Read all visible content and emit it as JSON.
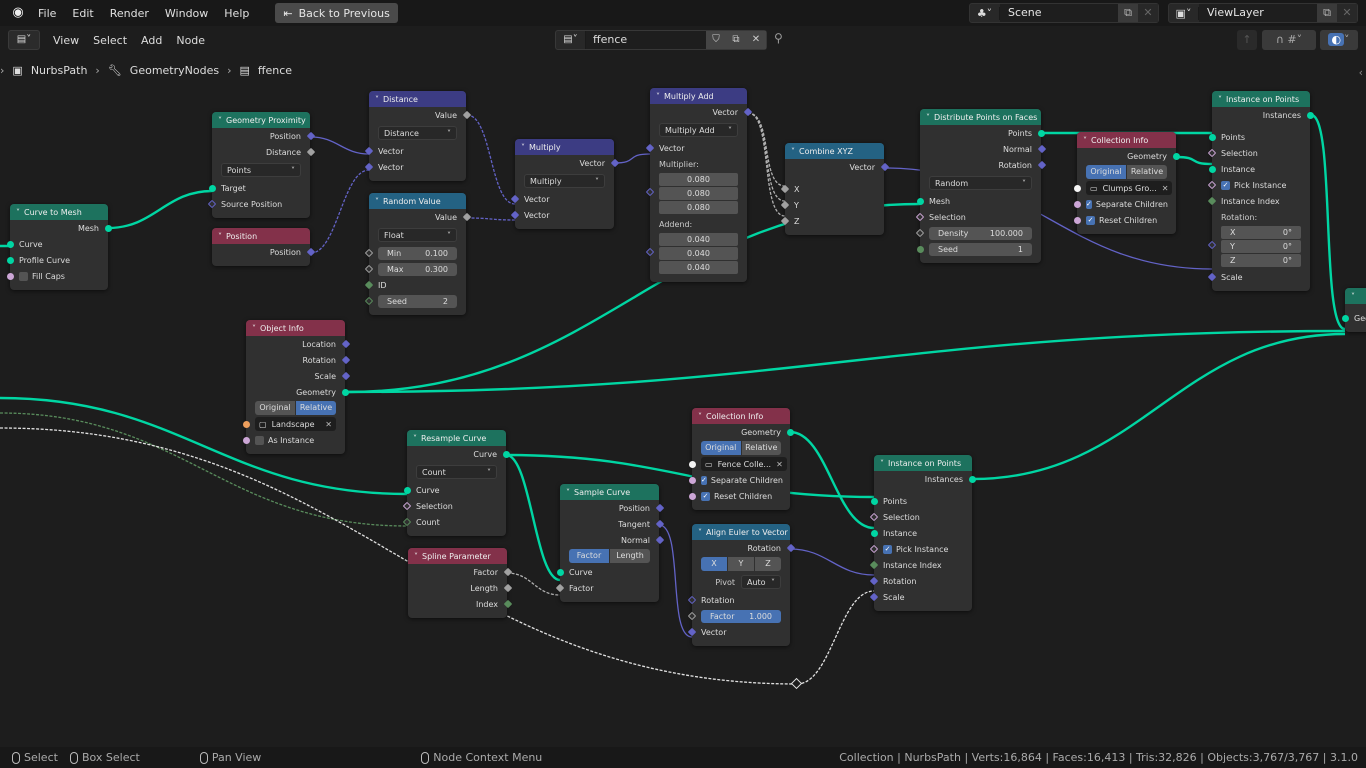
{
  "topbar": {
    "menus": [
      "File",
      "Edit",
      "Render",
      "Window",
      "Help"
    ],
    "back_button": "Back to Previous",
    "scene": "Scene",
    "view_layer": "ViewLayer"
  },
  "header": {
    "menus": [
      "View",
      "Select",
      "Add",
      "Node"
    ],
    "node_tree": "ffence"
  },
  "breadcrumb": [
    "NurbsPath",
    "GeometryNodes",
    "ffence"
  ],
  "colors": {
    "geometry_socket": "#00d6a3",
    "vector_socket": "#6363c7",
    "float_socket": "#a1a1a1",
    "bool_socket": "#cca6d6",
    "int_socket": "#598c5c",
    "object_socket": "#ed9e5c",
    "collection_socket": "#f5f5f5",
    "geometry_header": "#1d725e",
    "vector_header": "#3c3c83",
    "converter_header": "#246283",
    "input_header": "#83314a",
    "accent": "#4772b3"
  },
  "nodes": [
    {
      "title": "Curve to Mesh",
      "cat": "geometry",
      "rows": [
        {
          "t": "out",
          "label": "Mesh",
          "s": "geometry"
        },
        {
          "t": "in",
          "label": "Curve",
          "s": "geometry"
        },
        {
          "t": "in",
          "label": "Profile Curve",
          "s": "geometry"
        },
        {
          "t": "check",
          "label": "Fill Caps",
          "checked": false,
          "s": "bool"
        }
      ]
    },
    {
      "title": "Geometry Proximity",
      "cat": "geometry",
      "rows": [
        {
          "t": "out",
          "label": "Position",
          "s": "vector",
          "f": "d"
        },
        {
          "t": "out",
          "label": "Distance",
          "s": "float",
          "f": "d"
        },
        {
          "t": "select",
          "value": "Points"
        },
        {
          "t": "in",
          "label": "Target",
          "s": "geometry"
        },
        {
          "t": "in",
          "label": "Source Position",
          "s": "vector",
          "f": "dd"
        }
      ]
    },
    {
      "title": "Position",
      "cat": "input",
      "rows": [
        {
          "t": "out",
          "label": "Position",
          "s": "vector",
          "f": "d"
        }
      ]
    },
    {
      "title": "Distance",
      "cat": "vector",
      "rows": [
        {
          "t": "out",
          "label": "Value",
          "s": "float",
          "f": "d"
        },
        {
          "t": "select",
          "value": "Distance"
        },
        {
          "t": "in",
          "label": "Vector",
          "s": "vector",
          "f": "d"
        },
        {
          "t": "in",
          "label": "Vector",
          "s": "vector",
          "f": "d"
        }
      ]
    },
    {
      "title": "Random Value",
      "cat": "converter",
      "rows": [
        {
          "t": "out",
          "label": "Value",
          "s": "float",
          "f": "d"
        },
        {
          "t": "select",
          "value": "Float"
        },
        {
          "t": "field",
          "label": "Min",
          "value": "0.100",
          "s": "float",
          "f": "dd"
        },
        {
          "t": "field",
          "label": "Max",
          "value": "0.300",
          "s": "float",
          "f": "dd"
        },
        {
          "t": "in",
          "label": "ID",
          "s": "int",
          "f": "d"
        },
        {
          "t": "field",
          "label": "Seed",
          "value": "2",
          "s": "int",
          "f": "dd"
        }
      ]
    },
    {
      "title": "Multiply",
      "cat": "vector",
      "rows": [
        {
          "t": "out",
          "label": "Vector",
          "s": "vector",
          "f": "d"
        },
        {
          "t": "select",
          "value": "Multiply"
        },
        {
          "t": "in",
          "label": "Vector",
          "s": "vector",
          "f": "d"
        },
        {
          "t": "in",
          "label": "Vector",
          "s": "vector",
          "f": "d"
        }
      ]
    },
    {
      "title": "Multiply Add",
      "cat": "vector",
      "rows": [
        {
          "t": "out",
          "label": "Vector",
          "s": "vector",
          "f": "d"
        },
        {
          "t": "select",
          "value": "Multiply Add"
        },
        {
          "t": "in",
          "label": "Vector",
          "s": "vector",
          "f": "d"
        },
        {
          "t": "label",
          "label": "Multiplier:"
        },
        {
          "t": "vec",
          "values": [
            "0.080",
            "0.080",
            "0.080"
          ],
          "s": "vector",
          "f": "dd"
        },
        {
          "t": "label",
          "label": "Addend:"
        },
        {
          "t": "vec",
          "values": [
            "0.040",
            "0.040",
            "0.040"
          ],
          "s": "vector",
          "f": "dd"
        }
      ]
    },
    {
      "title": "Combine XYZ",
      "cat": "converter",
      "rows": [
        {
          "t": "out",
          "label": "Vector",
          "s": "vector",
          "f": "d"
        },
        {
          "t": "gap"
        },
        {
          "t": "in",
          "label": "X",
          "s": "float",
          "f": "d"
        },
        {
          "t": "in",
          "label": "Y",
          "s": "float",
          "f": "d"
        },
        {
          "t": "in",
          "label": "Z",
          "s": "float",
          "f": "d"
        }
      ]
    },
    {
      "title": "Distribute Points on Faces",
      "cat": "geometry",
      "rows": [
        {
          "t": "out",
          "label": "Points",
          "s": "geometry"
        },
        {
          "t": "out",
          "label": "Normal",
          "s": "vector",
          "f": "d"
        },
        {
          "t": "out",
          "label": "Rotation",
          "s": "vector",
          "f": "d"
        },
        {
          "t": "select",
          "value": "Random"
        },
        {
          "t": "in",
          "label": "Mesh",
          "s": "geometry"
        },
        {
          "t": "in",
          "label": "Selection",
          "s": "bool",
          "f": "dd"
        },
        {
          "t": "field",
          "label": "Density",
          "value": "100.000",
          "s": "float",
          "f": "dd"
        },
        {
          "t": "field",
          "label": "Seed",
          "value": "1",
          "s": "int"
        }
      ]
    },
    {
      "title": "Collection Info",
      "cat": "input",
      "rows": [
        {
          "t": "out",
          "label": "Geometry",
          "s": "geometry"
        },
        {
          "t": "toggle",
          "options": [
            "Original",
            "Relative"
          ],
          "active": 0
        },
        {
          "t": "obj",
          "value": "Clumps Gro...",
          "s": "collection"
        },
        {
          "t": "check",
          "label": "Separate Children",
          "checked": true,
          "s": "bool"
        },
        {
          "t": "check",
          "label": "Reset Children",
          "checked": true,
          "s": "bool"
        }
      ]
    },
    {
      "title": "Instance on Points",
      "cat": "geometry",
      "rows": [
        {
          "t": "out",
          "label": "Instances",
          "s": "geometry"
        },
        {
          "t": "gap"
        },
        {
          "t": "in",
          "label": "Points",
          "s": "geometry"
        },
        {
          "t": "in",
          "label": "Selection",
          "s": "bool",
          "f": "dd"
        },
        {
          "t": "in",
          "label": "Instance",
          "s": "geometry"
        },
        {
          "t": "check",
          "label": "Pick Instance",
          "checked": true,
          "s": "bool",
          "f": "dd"
        },
        {
          "t": "in",
          "label": "Instance Index",
          "s": "int",
          "f": "d"
        },
        {
          "t": "label",
          "label": "Rotation:"
        },
        {
          "t": "vec",
          "labels": [
            "X",
            "Y",
            "Z"
          ],
          "values": [
            "0°",
            "0°",
            "0°"
          ],
          "s": "vector",
          "f": "dd"
        },
        {
          "t": "in",
          "label": "Scale",
          "s": "vector",
          "f": "d"
        }
      ]
    },
    {
      "title": "",
      "cat": "geometry",
      "rows": [
        {
          "t": "gap"
        },
        {
          "t": "in",
          "label": "Geometry",
          "s": "geometry"
        }
      ]
    },
    {
      "title": "Object Info",
      "cat": "input",
      "rows": [
        {
          "t": "out",
          "label": "Location",
          "s": "vector",
          "f": "d"
        },
        {
          "t": "out",
          "label": "Rotation",
          "s": "vector",
          "f": "d"
        },
        {
          "t": "out",
          "label": "Scale",
          "s": "vector",
          "f": "d"
        },
        {
          "t": "out",
          "label": "Geometry",
          "s": "geometry"
        },
        {
          "t": "toggle",
          "options": [
            "Original",
            "Relative"
          ],
          "active": 1
        },
        {
          "t": "obj",
          "value": "Landscape",
          "s": "object"
        },
        {
          "t": "check",
          "label": "As Instance",
          "checked": false,
          "s": "bool"
        }
      ]
    },
    {
      "title": "Resample Curve",
      "cat": "geometry",
      "rows": [
        {
          "t": "out",
          "label": "Curve",
          "s": "geometry"
        },
        {
          "t": "select",
          "value": "Count"
        },
        {
          "t": "in",
          "label": "Curve",
          "s": "geometry"
        },
        {
          "t": "in",
          "label": "Selection",
          "s": "bool",
          "f": "dd"
        },
        {
          "t": "in",
          "label": "Count",
          "s": "int",
          "f": "dd"
        }
      ]
    },
    {
      "title": "Spline Parameter",
      "cat": "input",
      "rows": [
        {
          "t": "out",
          "label": "Factor",
          "s": "float",
          "f": "d"
        },
        {
          "t": "out",
          "label": "Length",
          "s": "float",
          "f": "d"
        },
        {
          "t": "out",
          "label": "Index",
          "s": "int",
          "f": "d"
        }
      ]
    },
    {
      "title": "Sample Curve",
      "cat": "geometry",
      "rows": [
        {
          "t": "out",
          "label": "Position",
          "s": "vector",
          "f": "d"
        },
        {
          "t": "out",
          "label": "Tangent",
          "s": "vector",
          "f": "d"
        },
        {
          "t": "out",
          "label": "Normal",
          "s": "vector",
          "f": "d"
        },
        {
          "t": "toggle",
          "options": [
            "Factor",
            "Length"
          ],
          "active": 0
        },
        {
          "t": "in",
          "label": "Curve",
          "s": "geometry"
        },
        {
          "t": "in",
          "label": "Factor",
          "s": "float",
          "f": "d"
        }
      ]
    },
    {
      "title": "Collection Info",
      "cat": "input",
      "rows": [
        {
          "t": "out",
          "label": "Geometry",
          "s": "geometry"
        },
        {
          "t": "toggle",
          "options": [
            "Original",
            "Relative"
          ],
          "active": 0
        },
        {
          "t": "obj",
          "value": "Fence Colle...",
          "s": "collection"
        },
        {
          "t": "check",
          "label": "Separate Children",
          "checked": true,
          "s": "bool"
        },
        {
          "t": "check",
          "label": "Reset Children",
          "checked": true,
          "s": "bool"
        }
      ]
    },
    {
      "title": "Align Euler to Vector",
      "cat": "converter",
      "rows": [
        {
          "t": "out",
          "label": "Rotation",
          "s": "vector",
          "f": "d"
        },
        {
          "t": "toggle",
          "options": [
            "X",
            "Y",
            "Z"
          ],
          "active": 0
        },
        {
          "t": "pivot",
          "label": "Pivot",
          "value": "Auto"
        },
        {
          "t": "in",
          "label": "Rotation",
          "s": "vector",
          "f": "dd"
        },
        {
          "t": "field",
          "label": "Factor",
          "value": "1.000",
          "fill": 1.0,
          "s": "float",
          "f": "dd"
        },
        {
          "t": "in",
          "label": "Vector",
          "s": "vector",
          "f": "d"
        }
      ]
    },
    {
      "title": "Instance on Points",
      "cat": "geometry",
      "rows": [
        {
          "t": "out",
          "label": "Instances",
          "s": "geometry"
        },
        {
          "t": "gap"
        },
        {
          "t": "in",
          "label": "Points",
          "s": "geometry"
        },
        {
          "t": "in",
          "label": "Selection",
          "s": "bool",
          "f": "dd"
        },
        {
          "t": "in",
          "label": "Instance",
          "s": "geometry"
        },
        {
          "t": "check",
          "label": "Pick Instance",
          "checked": true,
          "s": "bool",
          "f": "dd"
        },
        {
          "t": "in",
          "label": "Instance Index",
          "s": "int",
          "f": "d"
        },
        {
          "t": "in",
          "label": "Rotation",
          "s": "vector",
          "f": "d"
        },
        {
          "t": "in",
          "label": "Scale",
          "s": "vector",
          "f": "d"
        }
      ]
    }
  ],
  "statusbar": {
    "select": "Select",
    "box_select": "Box Select",
    "pan_view": "Pan View",
    "context_menu": "Node Context Menu",
    "stats": "Collection | NurbsPath | Verts:16,864 | Faces:16,413 | Tris:32,826 | Objects:3,767/3,767 | 3.1.0"
  }
}
